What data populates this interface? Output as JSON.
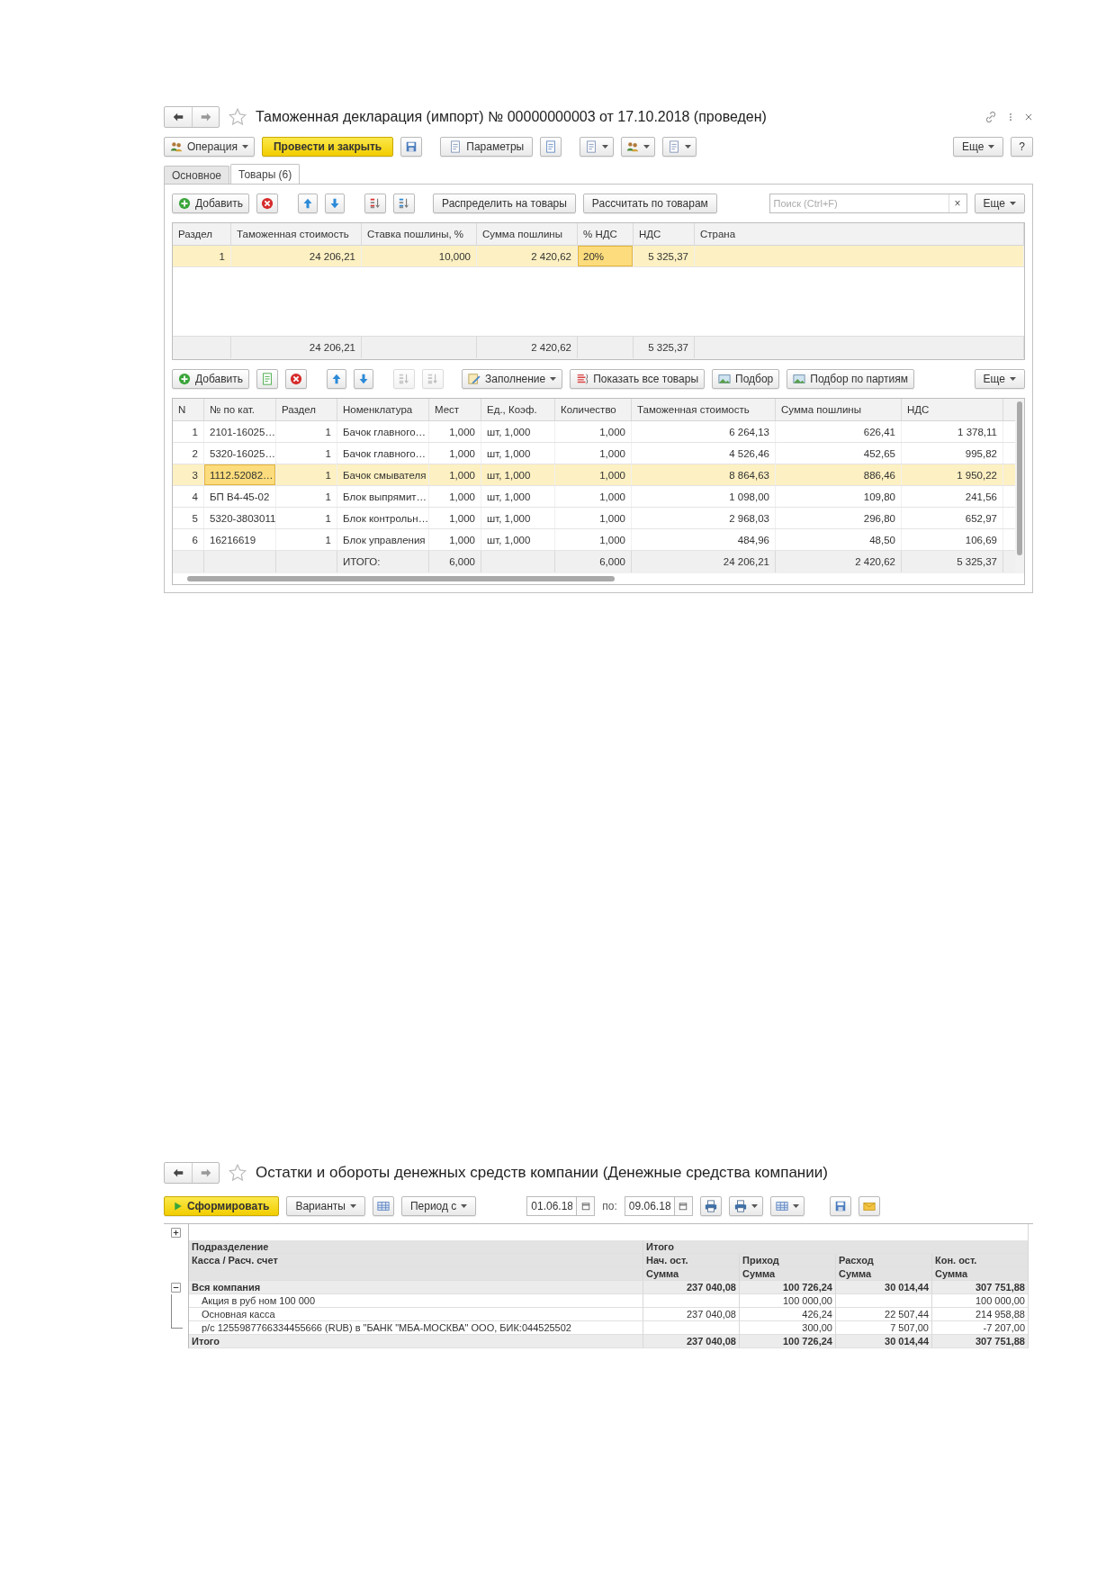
{
  "document": {
    "title": "Таможенная декларация (импорт) № 00000000003 от 17.10.2018 (проведен)",
    "toolbar": {
      "operation": "Операция",
      "post_and_close": "Провести и закрыть",
      "parameters": "Параметры",
      "more": "Еще",
      "help": "?"
    },
    "tabs": [
      {
        "label": "Основное",
        "selected": false
      },
      {
        "label": "Товары (6)",
        "selected": true
      }
    ],
    "sections_toolbar": {
      "add": "Добавить",
      "distribute": "Распределить на товары",
      "calculate": "Рассчитать по товарам",
      "search_placeholder": "Поиск (Ctrl+F)",
      "clear": "×",
      "more": "Еще"
    },
    "sections_table": {
      "columns": [
        "Раздел",
        "Таможенная стоимость",
        "Ставка пошлины, %",
        "Сумма пошлины",
        "% НДС",
        "НДС",
        "Страна"
      ],
      "rows": [
        {
          "selected": true,
          "cells": [
            {
              "text": "1",
              "focused": false
            },
            {
              "text": "24 206,21",
              "focused": false
            },
            {
              "text": "10,000",
              "focused": false
            },
            {
              "text": "2 420,62",
              "focused": false
            },
            {
              "text": "20%",
              "focused": true
            },
            {
              "text": "5 325,37",
              "focused": false
            },
            {
              "focused": false
            }
          ]
        }
      ],
      "footer": {
        "customs_value": "24 206,21",
        "duty_sum": "2 420,62",
        "vat": "5 325,37"
      }
    },
    "goods_toolbar": {
      "add": "Добавить",
      "fill": "Заполнение",
      "show_all": "Показать все товары",
      "pick": "Подбор",
      "pick_batches": "Подбор по партиям",
      "more": "Еще"
    },
    "goods_table": {
      "columns": [
        "N",
        "№ по кат.",
        "Раздел",
        "Номенклатура",
        "Мест",
        "Ед., Коэф.",
        "Количество",
        "Таможенная стоимость",
        "Сумма пошлины",
        "НДС"
      ],
      "rows": [
        {
          "selected": false,
          "cells": [
            {
              "text": "1",
              "focused": false
            },
            {
              "text": "2101-16025…",
              "focused": false
            },
            {
              "text": "1",
              "focused": false
            },
            {
              "text": "Бачок главного…",
              "focused": false
            },
            {
              "text": "1,000",
              "focused": false
            },
            {
              "text": "шт, 1,000",
              "focused": false
            },
            {
              "text": "1,000",
              "focused": false
            },
            {
              "text": "6 264,13",
              "focused": false
            },
            {
              "text": "626,41",
              "focused": false
            },
            {
              "text": "1 378,11",
              "focused": false
            }
          ]
        },
        {
          "selected": false,
          "cells": [
            {
              "text": "2",
              "focused": false
            },
            {
              "text": "5320-16025…",
              "focused": false
            },
            {
              "text": "1",
              "focused": false
            },
            {
              "text": "Бачок главного…",
              "focused": false
            },
            {
              "text": "1,000",
              "focused": false
            },
            {
              "text": "шт, 1,000",
              "focused": false
            },
            {
              "text": "1,000",
              "focused": false
            },
            {
              "text": "4 526,46",
              "focused": false
            },
            {
              "text": "452,65",
              "focused": false
            },
            {
              "text": "995,82",
              "focused": false
            }
          ]
        },
        {
          "selected": true,
          "cells": [
            {
              "text": "3",
              "focused": false
            },
            {
              "text": "1112.52082…",
              "focused": true
            },
            {
              "text": "1",
              "focused": false
            },
            {
              "text": "Бачок смывателя",
              "focused": false
            },
            {
              "text": "1,000",
              "focused": false
            },
            {
              "text": "шт, 1,000",
              "focused": false
            },
            {
              "text": "1,000",
              "focused": false
            },
            {
              "text": "8 864,63",
              "focused": false
            },
            {
              "text": "886,46",
              "focused": false
            },
            {
              "text": "1 950,22",
              "focused": false
            }
          ]
        },
        {
          "selected": false,
          "cells": [
            {
              "text": "4",
              "focused": false
            },
            {
              "text": "БП В4-45-02",
              "focused": false
            },
            {
              "text": "1",
              "focused": false
            },
            {
              "text": "Блок выпрямит…",
              "focused": false
            },
            {
              "text": "1,000",
              "focused": false
            },
            {
              "text": "шт, 1,000",
              "focused": false
            },
            {
              "text": "1,000",
              "focused": false
            },
            {
              "text": "1 098,00",
              "focused": false
            },
            {
              "text": "109,80",
              "focused": false
            },
            {
              "text": "241,56",
              "focused": false
            }
          ]
        },
        {
          "selected": false,
          "cells": [
            {
              "text": "5",
              "focused": false
            },
            {
              "text": "5320-3803011",
              "focused": false
            },
            {
              "text": "1",
              "focused": false
            },
            {
              "text": "Блок контрольн…",
              "focused": false
            },
            {
              "text": "1,000",
              "focused": false
            },
            {
              "text": "шт, 1,000",
              "focused": false
            },
            {
              "text": "1,000",
              "focused": false
            },
            {
              "text": "2 968,03",
              "focused": false
            },
            {
              "text": "296,80",
              "focused": false
            },
            {
              "text": "652,97",
              "focused": false
            }
          ]
        },
        {
          "selected": false,
          "cells": [
            {
              "text": "6",
              "focused": false
            },
            {
              "text": "16216619",
              "focused": false
            },
            {
              "text": "1",
              "focused": false
            },
            {
              "text": "Блок управления",
              "focused": false
            },
            {
              "text": "1,000",
              "focused": false
            },
            {
              "text": "шт, 1,000",
              "focused": false
            },
            {
              "text": "1,000",
              "focused": false
            },
            {
              "text": "484,96",
              "focused": false
            },
            {
              "text": "48,50",
              "focused": false
            },
            {
              "text": "106,69",
              "focused": false
            }
          ]
        }
      ],
      "footer": {
        "label": "ИТОГО:",
        "places": "6,000",
        "quantity": "6,000",
        "customs_value": "24 206,21",
        "duty_sum": "2 420,62",
        "vat": "5 325,37"
      }
    }
  },
  "report": {
    "title": "Остатки и обороты денежных средств компании (Денежные средства компании)",
    "toolbar": {
      "generate": "Сформировать",
      "variants": "Варианты",
      "period": "Период с",
      "date_from": "01.06.18",
      "to_label": "по:",
      "date_to": "09.06.18"
    },
    "header": {
      "group_label": "Подразделение",
      "row_label": "Касса / Расч. счет",
      "total_label": "Итого",
      "columns": [
        {
          "name": "Нач. ост.",
          "measure": "Сумма"
        },
        {
          "name": "Приход",
          "measure": "Сумма"
        },
        {
          "name": "Расход",
          "measure": "Сумма"
        },
        {
          "name": "Кон. ост.",
          "measure": "Сумма"
        }
      ]
    },
    "rows": [
      {
        "kind": "group",
        "expanded": true,
        "label": "Вся компания",
        "values": {
          "opening": "237 040,08",
          "income": "100 726,24",
          "expense": "30 014,44",
          "closing": "307 751,88"
        }
      },
      {
        "kind": "item",
        "label": "Акция в руб ном 100 000",
        "values": {
          "income": "100 000,00",
          "closing": "100 000,00"
        }
      },
      {
        "kind": "item",
        "label": "Основная касса",
        "values": {
          "opening": "237 040,08",
          "income": "426,24",
          "expense": "22 507,44",
          "closing": "214 958,88"
        }
      },
      {
        "kind": "item",
        "label": "р/с 1255987766334455666 (RUB) в \"БАНК \"МБА-МОСКВА\" ООО, БИК:044525502",
        "values": {
          "income": "300,00",
          "expense": "7 507,00",
          "closing": "-7 207,00"
        }
      },
      {
        "kind": "total",
        "label": "Итого",
        "values": {
          "opening": "237 040,08",
          "income": "100 726,24",
          "expense": "30 014,44",
          "closing": "307 751,88"
        }
      }
    ]
  }
}
